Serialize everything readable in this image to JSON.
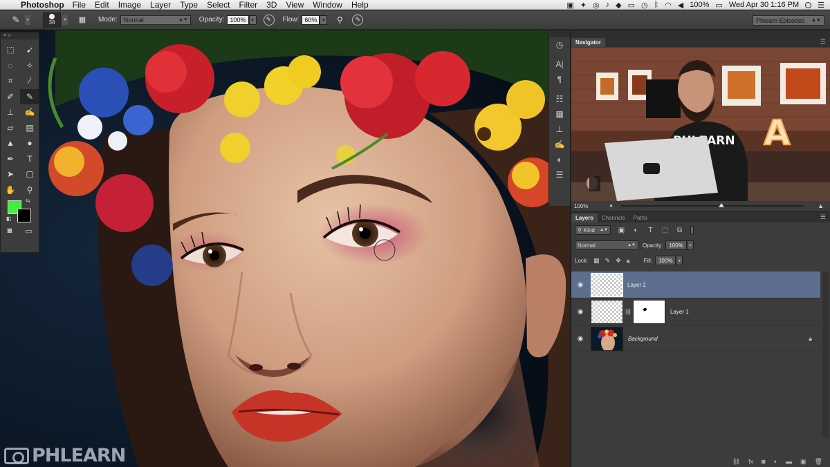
{
  "menubar": {
    "app_name": "Photoshop",
    "menus": [
      "File",
      "Edit",
      "Image",
      "Layer",
      "Type",
      "Select",
      "Filter",
      "3D",
      "View",
      "Window",
      "Help"
    ],
    "battery": "100%",
    "datetime": "Wed Apr 30  1:16 PM"
  },
  "options": {
    "brush_size": "38",
    "mode_label": "Mode:",
    "mode_value": "Normal",
    "opacity_label": "Opacity:",
    "opacity_value": "100%",
    "flow_label": "Flow:",
    "flow_value": "60%",
    "workspace": "Phlearn Episodes"
  },
  "colors": {
    "foreground": "#3ef03c",
    "background": "#000000",
    "selection": "#5e6e8e"
  },
  "tools": [
    "marquee-icon",
    "move-icon",
    "lasso-icon",
    "magic-wand-icon",
    "crop-icon",
    "eyedropper-icon",
    "healing-brush-icon",
    "brush-icon",
    "clone-stamp-icon",
    "history-brush-icon",
    "eraser-icon",
    "gradient-icon",
    "blur-icon",
    "dodge-icon",
    "pen-icon",
    "type-icon",
    "path-selection-icon",
    "shape-icon",
    "hand-icon",
    "zoom-icon"
  ],
  "navigator": {
    "tab": "Navigator",
    "zoom": "100%",
    "zoom_level": 0.55,
    "shirt_text": "PHLEARN",
    "sign_letter": "A"
  },
  "layers_panel": {
    "tabs": [
      "Layers",
      "Channels",
      "Paths"
    ],
    "filter_kind": "Kind",
    "blend_mode": "Normal",
    "opacity_label": "Opacity:",
    "opacity_value": "100%",
    "lock_label": "Lock:",
    "fill_label": "Fill:",
    "fill_value": "100%",
    "layers": [
      {
        "name": "Layer 2",
        "selected": true
      },
      {
        "name": "Layer 1",
        "has_mask": true
      },
      {
        "name": "Background",
        "locked": true
      }
    ]
  },
  "watermark": "PHLEARN"
}
